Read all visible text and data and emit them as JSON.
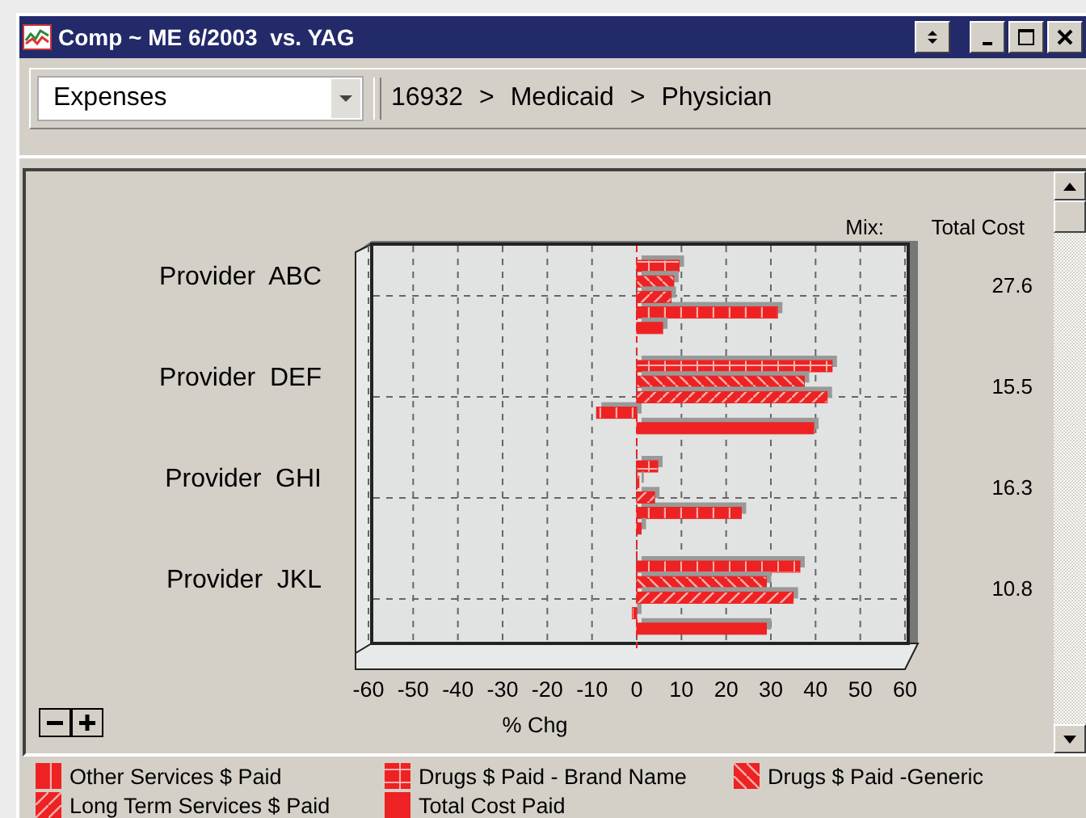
{
  "window": {
    "title": "Comp ~ ME 6/2003  vs. YAG"
  },
  "toolbar": {
    "dropdown": {
      "value": "Expenses"
    },
    "breadcrumb": [
      "16932",
      ">",
      "Medicaid",
      ">",
      "Physician"
    ]
  },
  "chart": {
    "chart_data": {
      "type": "bar",
      "orientation": "horizontal",
      "xlabel": "% Chg",
      "categories": [
        "Provider  ABC",
        "Provider  DEF",
        "Provider  GHI",
        "Provider  JKL"
      ],
      "xlim": [
        -60,
        60
      ],
      "xticks": [
        -60,
        -50,
        -40,
        -30,
        -20,
        -10,
        0,
        10,
        20,
        30,
        40,
        50,
        60
      ],
      "grid": true,
      "ref_lines": [
        {
          "axis": "x",
          "value": 0
        }
      ],
      "series": [
        {
          "name": "Other Services $ Paid",
          "color": "#ee2222",
          "values": [
            31.5,
            -9,
            23.4,
            -1
          ]
        },
        {
          "name": "Drugs $ Paid - Brand Name",
          "color": "#ee2222",
          "values": [
            9.5,
            43.7,
            4.7,
            36.5
          ]
        },
        {
          "name": "Drugs $ Paid -Generic",
          "color": "#ee2222",
          "values": [
            8.3,
            37.5,
            0.5,
            29
          ]
        },
        {
          "name": "Long Term Services $ Paid",
          "color": "#ee2222",
          "values": [
            7.7,
            42.6,
            4,
            35
          ]
        },
        {
          "name": "Total Cost Paid",
          "color": "#ee2222",
          "values": [
            5.8,
            39.6,
            1,
            29
          ]
        }
      ]
    },
    "mix_label": "Mix:",
    "total_cost_header": "Total Cost",
    "total_cost": [
      "27.6",
      "15.5",
      "16.3",
      "10.8"
    ]
  }
}
